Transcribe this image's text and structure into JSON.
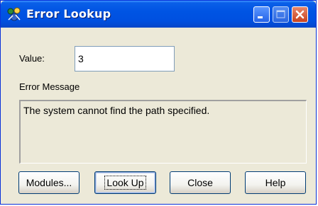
{
  "window": {
    "title": "Error Lookup",
    "title_color": "#ffffff",
    "titlebar_color": "#0054e3"
  },
  "form": {
    "value_label": "Value:",
    "value": "3",
    "message_label": "Error Message",
    "message": "The system cannot find the path specified."
  },
  "buttons": {
    "modules": "Modules...",
    "lookup": "Look Up",
    "close": "Close",
    "help": "Help"
  },
  "icons": {
    "app": "error-lookup-app-icon",
    "minimize": "minimize-icon",
    "maximize": "maximize-icon",
    "close": "close-x-icon"
  }
}
